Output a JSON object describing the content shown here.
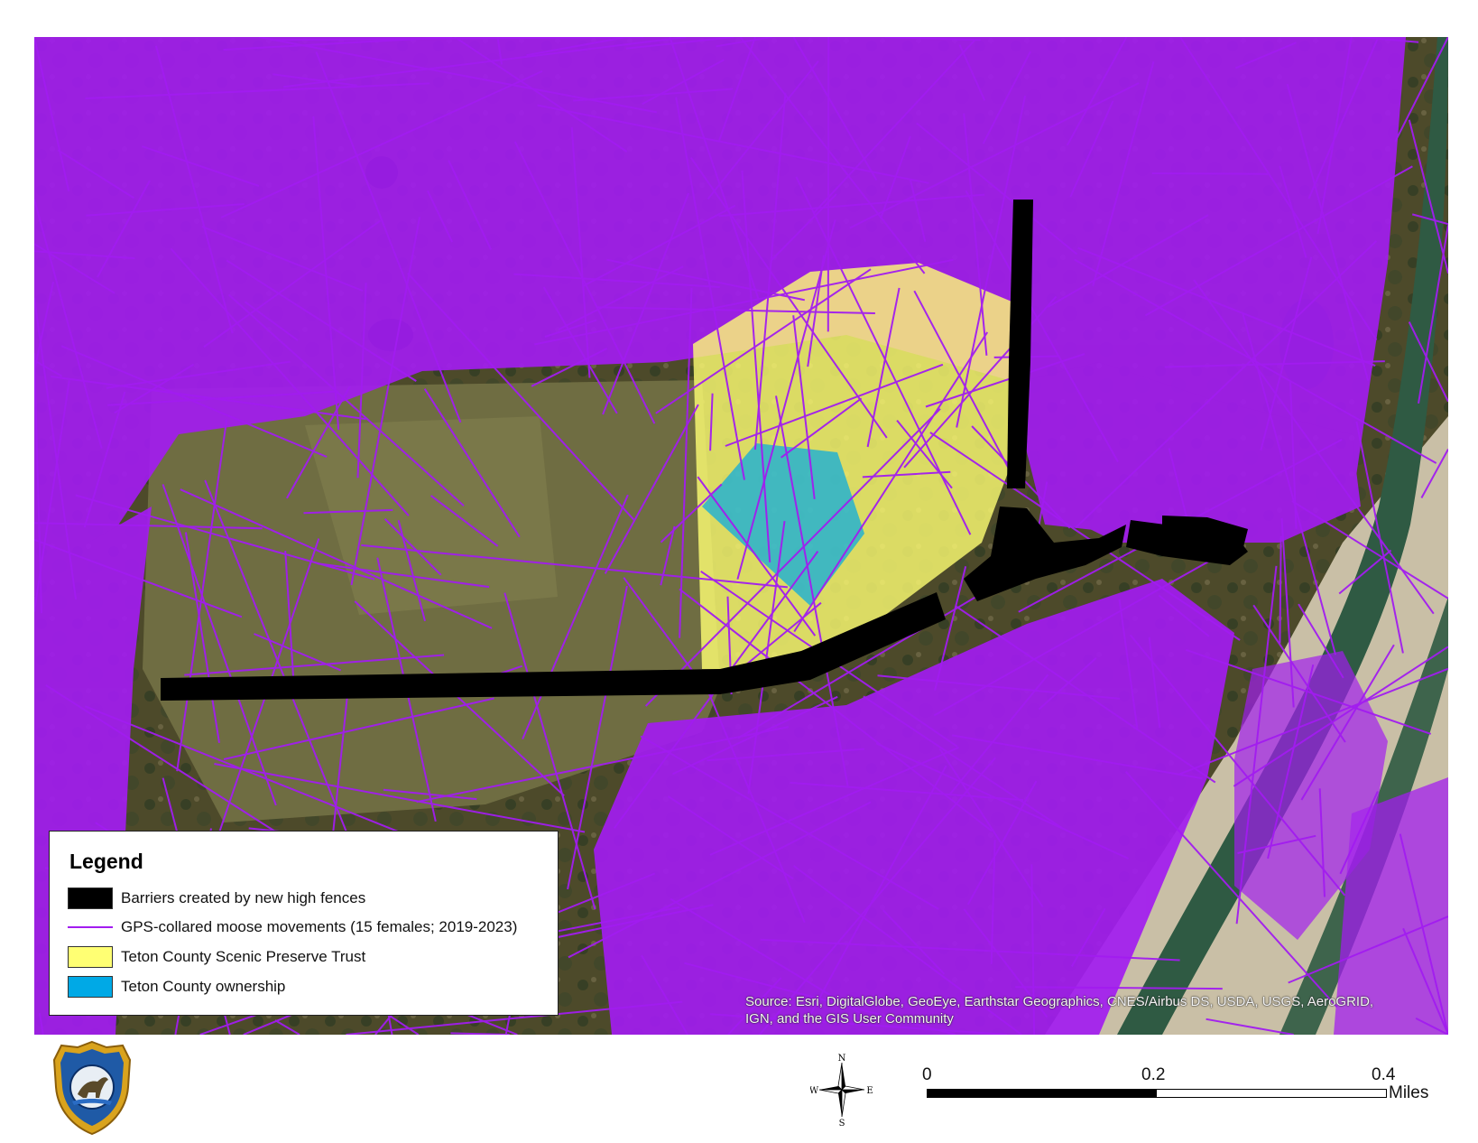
{
  "legend": {
    "title": "Legend",
    "items": [
      {
        "label": "Barriers created by new high fences",
        "color": "#000000",
        "kind": "fill"
      },
      {
        "label": "GPS-collared moose movements (15 females; 2019-2023)",
        "color": "#a21cf0",
        "kind": "line"
      },
      {
        "label": "Teton County Scenic Preserve Trust",
        "color": "#ffff73",
        "kind": "fill"
      },
      {
        "label": "Teton County ownership",
        "color": "#00a9e6",
        "kind": "fill"
      }
    ]
  },
  "source": {
    "text": "Source: Esri, DigitalGlobe, GeoEye, Earthstar Geographics, CNES/Airbus DS, USDA, USGS, AeroGRID, IGN, and the GIS User Community"
  },
  "compass": {
    "n": "N",
    "s": "S",
    "e": "E",
    "w": "W"
  },
  "scale": {
    "ticks": [
      "0",
      "0.2",
      "0.4"
    ],
    "unit": "Miles",
    "filled_fraction": 0.5
  },
  "colors": {
    "moose_track": "#a21cf0",
    "fence": "#000000",
    "preserve": "#ffff73",
    "county": "#00a9e6",
    "river": "#2f5a43",
    "riverbed": "#c9bfa6",
    "field": "#6b6a3c"
  },
  "icons": {
    "logo": "wyoming-game-fish-badge-icon",
    "north_arrow": "compass-rose-icon"
  }
}
